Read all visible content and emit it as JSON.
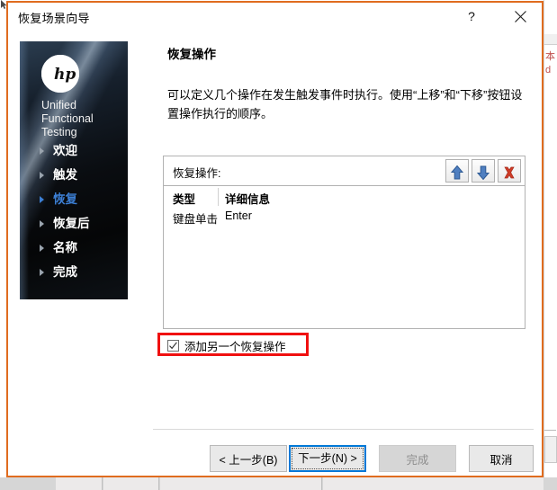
{
  "window": {
    "title": "恢复场景向导",
    "help_icon": "question-mark-icon",
    "close_icon": "close-icon",
    "help_label": "?",
    "border_color": "#e06c1f"
  },
  "sidebar": {
    "brand": {
      "logo": "hp-logo-icon",
      "product": "Unified Functional Testing"
    },
    "items": [
      {
        "label": "欢迎",
        "active": false
      },
      {
        "label": "触发",
        "active": false
      },
      {
        "label": "恢复",
        "active": true
      },
      {
        "label": "恢复后",
        "active": false
      },
      {
        "label": "名称",
        "active": false
      },
      {
        "label": "完成",
        "active": false
      }
    ],
    "active_color": "#3c7fd4"
  },
  "main": {
    "title": "恢复操作",
    "description": "可以定义几个操作在发生触发事件时执行。使用“上移”和“下移”按钮设置操作执行的顺序。",
    "list_toolbar": {
      "label": "恢复操作:",
      "buttons": [
        {
          "name": "move-up-button",
          "icon": "arrow-up-icon",
          "color": "#3f6fb0"
        },
        {
          "name": "move-down-button",
          "icon": "arrow-down-icon",
          "color": "#3f6fb0"
        },
        {
          "name": "delete-button",
          "icon": "red-x-icon",
          "color": "#cc3322"
        }
      ]
    },
    "table": {
      "columns": [
        "类型",
        "详细信息"
      ],
      "rows": [
        {
          "type": "键盘单击",
          "detail": "Enter"
        }
      ]
    },
    "checkbox": {
      "label": "添加另一个恢复操作",
      "checked": true,
      "highlight_color": "#f01010"
    }
  },
  "footer": {
    "buttons": [
      {
        "name": "back-button",
        "prefix": "< ",
        "text": "上一步(",
        "accel": "B",
        "suffix": ")",
        "disabled": false,
        "focused": false
      },
      {
        "name": "next-button",
        "prefix": "",
        "text": "下一步(",
        "accel": "N",
        "suffix": ") >",
        "disabled": false,
        "focused": true
      },
      {
        "name": "finish-button",
        "prefix": "",
        "text": "完成",
        "accel": "",
        "suffix": "",
        "disabled": true,
        "focused": false
      },
      {
        "name": "cancel-button",
        "prefix": "",
        "text": "取消",
        "accel": "",
        "suffix": "",
        "disabled": false,
        "focused": false
      }
    ],
    "back_label": "< 上一步(B)",
    "next_label": "下一步(N) >",
    "finish_label": "完成",
    "cancel_label": "取消"
  },
  "background": {
    "right_text_line1": "本",
    "right_text_line2": "d",
    "bottom_cells": [
      "",
      "",
      "",
      ""
    ]
  }
}
